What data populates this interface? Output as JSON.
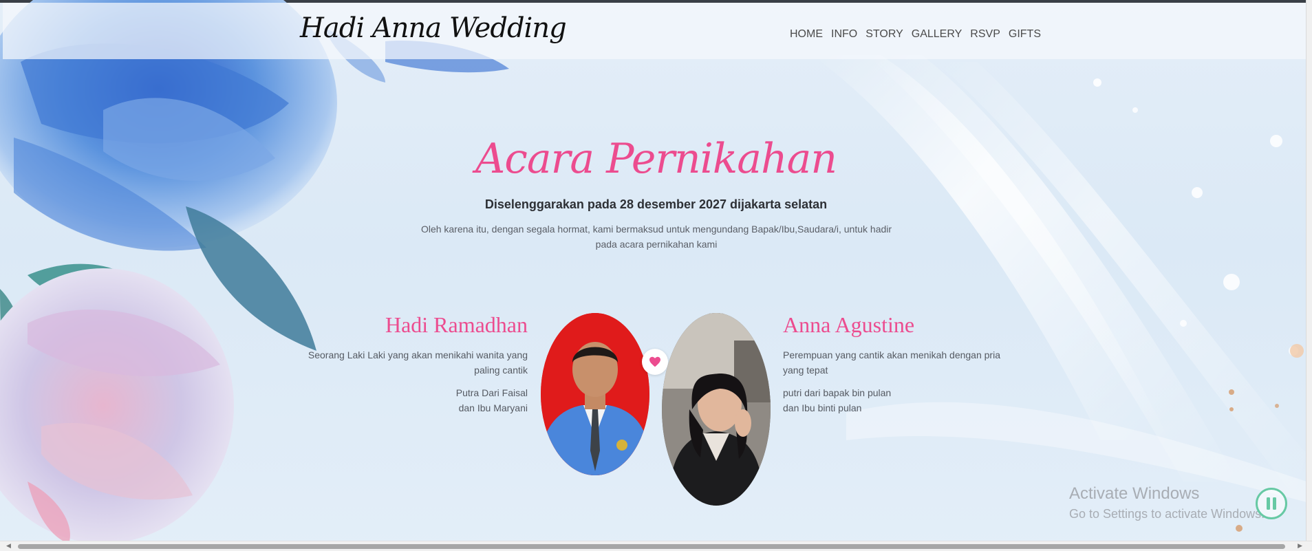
{
  "brand": "Hadi Anna Wedding",
  "nav": [
    "HOME",
    "INFO",
    "STORY",
    "GALLERY",
    "RSVP",
    "GIFTS"
  ],
  "event": {
    "title": "Acara Pernikahan",
    "subtitle": "Diselenggarakan pada 28 desember 2027 dijakarta selatan",
    "invitation": "Oleh karena itu, dengan segala hormat, kami bermaksud untuk mengundang Bapak/Ibu,Saudara/i, untuk hadir pada acara pernikahan kami"
  },
  "groom": {
    "name": "Hadi Ramadhan",
    "description": "Seorang Laki Laki yang akan menikahi wanita yang paling cantik",
    "parents_line1": "Putra Dari Faisal",
    "parents_line2": "dan Ibu Maryani"
  },
  "bride": {
    "name": "Anna Agustine",
    "description": "Perempuan yang cantik akan menikah dengan pria yang tepat",
    "parents_line1": "putri dari bapak bin pulan",
    "parents_line2": "dan Ibu binti pulan"
  },
  "system": {
    "watermark_title": "Activate Windows",
    "watermark_sub": "Go to Settings to activate Windows."
  },
  "colors": {
    "accent_pink": "#ec4c8f",
    "groom_photo_bg": "#e01b1b",
    "flower_blue": "#3a78d0"
  },
  "icons": [
    "heart-icon",
    "pause-icon"
  ]
}
